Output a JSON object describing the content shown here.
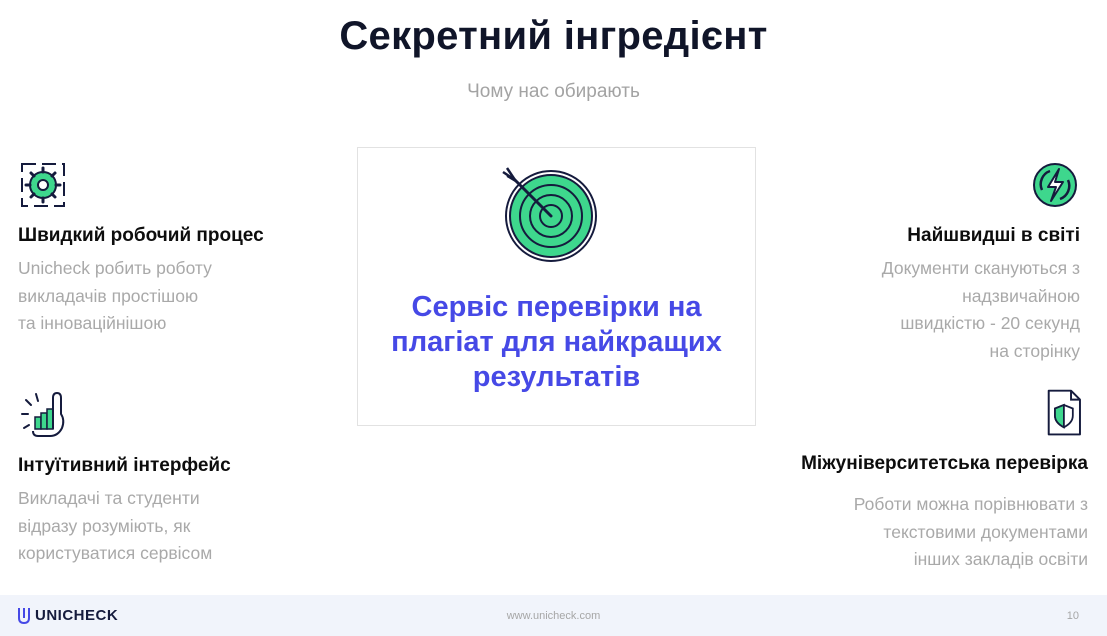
{
  "header": {
    "title": "Секретний інгредієнт",
    "subtitle": "Чому нас обирають"
  },
  "features": {
    "fast_workflow": {
      "icon": "gear-cycle-icon",
      "title": "Швидкий робочий процес",
      "lines": [
        "Unicheck робить роботу",
        "викладачів простішою",
        "та інноваційнішою"
      ]
    },
    "fastest": {
      "icon": "lightning-icon",
      "title": "Найшвидші в світі",
      "lines": [
        "Документи скануються з",
        "надзвичайною",
        "швидкістю - 20 секунд",
        "на сторінку"
      ]
    },
    "intuitive": {
      "icon": "hand-chart-icon",
      "title": "Інтуїтивний інтерфейс",
      "lines": [
        "Викладачі та студенти",
        "відразу розуміють, як",
        "користуватися сервісом"
      ]
    },
    "inter_university": {
      "icon": "shield-document-icon",
      "title": "Міжуніверситетська перевірка",
      "lines": [
        "Роботи можна порівнювати з",
        "текстовими документами",
        "інших закладів освіти"
      ]
    }
  },
  "center": {
    "icon": "target-icon",
    "lines": [
      "Сервіс перевірки на",
      "плагіат для найкращих",
      "результатів"
    ]
  },
  "footer": {
    "brand": "UNICHECK",
    "url": "www.unicheck.com",
    "page": "10"
  },
  "colors": {
    "accent_green": "#3ed78d",
    "accent_blue": "#4649e6",
    "dark": "#151b3d"
  }
}
